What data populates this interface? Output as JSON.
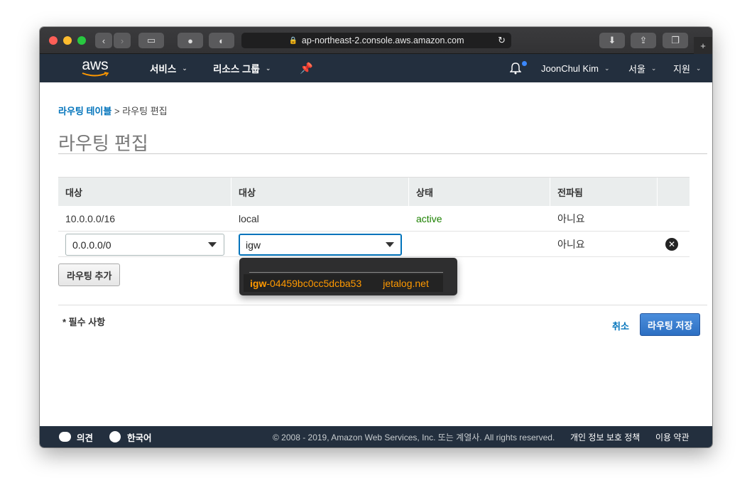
{
  "browser": {
    "url": "ap-northeast-2.console.aws.amazon.com",
    "colors": {
      "close": "#ff5f57",
      "minimize": "#febc2e",
      "zoom": "#28c840"
    }
  },
  "navbar": {
    "logo": "aws",
    "services": "서비스",
    "resource_groups": "리소스 그룹",
    "user": "JoonChul Kim",
    "region": "서울",
    "support": "지원"
  },
  "breadcrumb": {
    "parent": "라우팅 테이블",
    "separator": ">",
    "current": "라우팅 편집"
  },
  "page_title": "라우팅 편집",
  "table": {
    "headers": [
      "대상",
      "대상",
      "상태",
      "전파됨"
    ],
    "rows": [
      {
        "destination": "10.0.0.0/16",
        "target": "local",
        "status": "active",
        "propagated": "아니요"
      },
      {
        "destination": "0.0.0.0/0",
        "target": "igw",
        "status": "",
        "propagated": "아니요"
      }
    ]
  },
  "dropdown": {
    "match_prefix": "igw",
    "match_rest": "-04459bc0cc5dcba53",
    "name": "jetalog.net"
  },
  "add_route_button": "라우팅 추가",
  "required_note": "* 필수 사항",
  "cancel_link": "취소",
  "save_button": "라우팅 저장",
  "footer": {
    "feedback": "의견",
    "language": "한국어",
    "copyright": "© 2008 - 2019, Amazon Web Services, Inc. 또는 계열사. All rights reserved.",
    "privacy": "개인 정보 보호 정책",
    "terms": "이용 약관"
  },
  "colors": {
    "status_active": "#1d8102",
    "link": "#0073bb",
    "accent_orange": "#ff9900",
    "nav_bg": "#232f3e"
  }
}
